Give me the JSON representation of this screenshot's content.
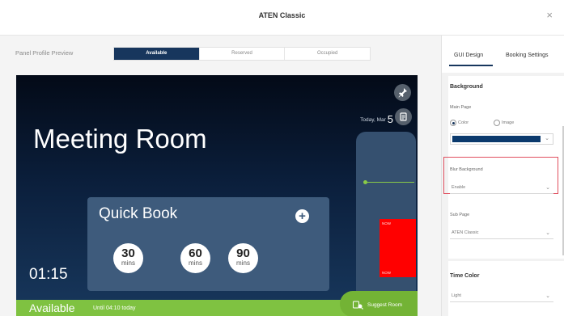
{
  "window": {
    "title": "ATEN Classic",
    "close_glyph": "×"
  },
  "preview": {
    "label": "Panel Profile Preview",
    "tabs": [
      {
        "label": "Available",
        "active": true
      },
      {
        "label": "Reserved",
        "active": false
      },
      {
        "label": "Occupied",
        "active": false
      }
    ]
  },
  "panel": {
    "room_name": "Meeting Room",
    "date_text": "Today, Mar",
    "date_day": "5",
    "timeline_block": {
      "top_label": "NOW",
      "bottom_label": "NOW",
      "color": "#ff0000"
    },
    "quick_book": {
      "title": "Quick Book",
      "plus_glyph": "+",
      "options": [
        {
          "value": "30",
          "unit": "mins"
        },
        {
          "value": "60",
          "unit": "mins"
        },
        {
          "value": "90",
          "unit": "mins"
        }
      ]
    },
    "clock": "01:15",
    "status": {
      "label": "Available",
      "detail": "Until 04:10 today",
      "color": "#7fc241"
    },
    "suggest_label": "Suggest Room",
    "icons": [
      "pin-icon",
      "calendar-icon",
      "room-suggest-icon"
    ]
  },
  "settings": {
    "tabs": [
      {
        "label": "GUI Design",
        "active": true
      },
      {
        "label": "Booking Settings",
        "active": false
      }
    ],
    "background": {
      "title": "Background",
      "main_page_label": "Main Page",
      "options": [
        {
          "label": "Color",
          "checked": true
        },
        {
          "label": "Image",
          "checked": false
        }
      ],
      "selected_color": "#0b3a6d"
    },
    "blur_background": {
      "label": "Blur Background",
      "value": "Enable"
    },
    "sub_page": {
      "label": "Sub Page",
      "value": "ATEN Classic"
    },
    "time_color": {
      "title": "Time Color",
      "value": "Light"
    },
    "highlight_color": "#e04f5f"
  }
}
